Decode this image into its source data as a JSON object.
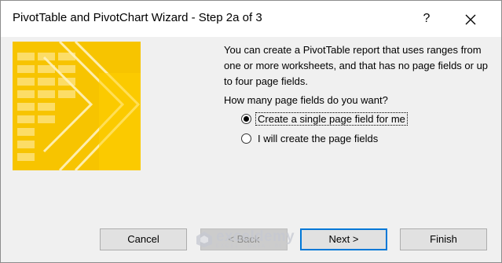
{
  "window": {
    "title": "PivotTable and PivotChart Wizard - Step 2a of 3",
    "help_label": "?"
  },
  "content": {
    "description": "You can create a PivotTable report that uses ranges from one or more worksheets, and that has no page fields or up to four page fields.",
    "question": "How many page fields do you want?",
    "options": [
      {
        "label": "Create a single page field for me",
        "selected": true
      },
      {
        "label": "I will create the page fields",
        "selected": false
      }
    ]
  },
  "buttons": {
    "cancel": "Cancel",
    "back": "< Back",
    "next": "Next >",
    "finish": "Finish"
  },
  "watermark": {
    "name": "exceldemy",
    "tagline": "EXCEL · DATA · BI"
  },
  "colors": {
    "accent": "#0078d7",
    "graphic_yellow": "#f7c400",
    "graphic_light": "#ffe680"
  }
}
